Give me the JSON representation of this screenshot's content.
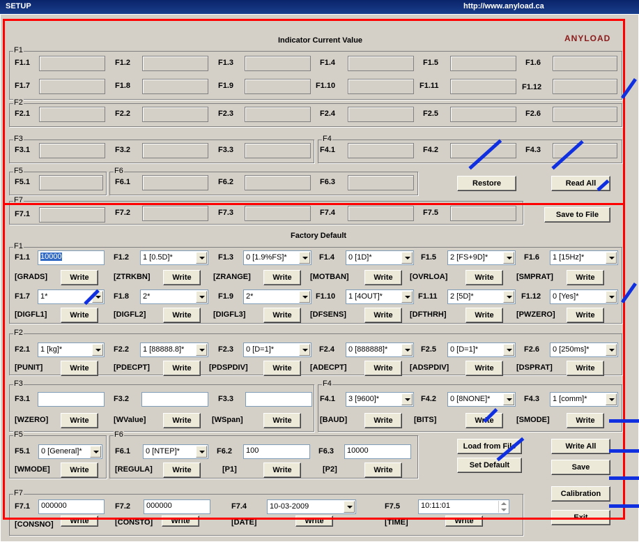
{
  "window": {
    "title": "SETUP",
    "url": "http://www.anyload.ca"
  },
  "brand": "ANYLOAD",
  "current": {
    "title": "Indicator Current Value",
    "groups": [
      "F1",
      "F2",
      "F3",
      "F4",
      "F5",
      "F6",
      "F7"
    ],
    "labels": {
      "f1_1": "F1.1",
      "f1_2": "F1.2",
      "f1_3": "F1.3",
      "f1_4": "F1.4",
      "f1_5": "F1.5",
      "f1_6": "F1.6",
      "f1_7": "F1.7",
      "f1_8": "F1.8",
      "f1_9": "F1.9",
      "f1_10": "F1.10",
      "f1_11": "F1.11",
      "f1_12": "F1.12",
      "f2_1": "F2.1",
      "f2_2": "F2.2",
      "f2_3": "F2.3",
      "f2_4": "F2.4",
      "f2_5": "F2.5",
      "f2_6": "F2.6",
      "f3_1": "F3.1",
      "f3_2": "F3.2",
      "f3_3": "F3.3",
      "f4_1": "F4.1",
      "f4_2": "F4.2",
      "f4_3": "F4.3",
      "f5_1": "F5.1",
      "f6_1": "F6.1",
      "f6_2": "F6.2",
      "f6_3": "F6.3",
      "f7_1": "F7.1",
      "f7_2": "F7.2",
      "f7_3": "F7.3",
      "f7_4": "F7.4",
      "f7_5": "F7.5"
    },
    "buttons": {
      "restore": "Restore",
      "read_all": "Read All",
      "save_to_file": "Save to File"
    }
  },
  "factory": {
    "title": "Factory Default",
    "groups": [
      "F1",
      "F2",
      "F3",
      "F4",
      "F5",
      "F6",
      "F7"
    ],
    "write_label": "Write",
    "f1": {
      "f1_1": {
        "label": "F1.1",
        "value": "10000",
        "code": "[GRADS]"
      },
      "f1_2": {
        "label": "F1.2",
        "value": "1 [0.5D]*",
        "code": "[ZTRKBN]"
      },
      "f1_3": {
        "label": "F1.3",
        "value": "0 [1.9%FS]*",
        "code": "[ZRANGE]"
      },
      "f1_4": {
        "label": "F1.4",
        "value": "0 [1D]*",
        "code": "[MOTBAN]"
      },
      "f1_5": {
        "label": "F1.5",
        "value": "2 [FS+9D]*",
        "code": "[OVRLOA]"
      },
      "f1_6": {
        "label": "F1.6",
        "value": "1 [15Hz]*",
        "code": "[SMPRAT]"
      },
      "f1_7": {
        "label": "F1.7",
        "value": "1*",
        "code": "[DIGFL1]"
      },
      "f1_8": {
        "label": "F1.8",
        "value": "2*",
        "code": "[DIGFL2]"
      },
      "f1_9": {
        "label": "F1.9",
        "value": "2*",
        "code": "[DIGFL3]"
      },
      "f1_10": {
        "label": "F1.10",
        "value": "1 [4OUT]*",
        "code": "[DFSENS]"
      },
      "f1_11": {
        "label": "F1.11",
        "value": "2 [5D]*",
        "code": "[DFTHRH]"
      },
      "f1_12": {
        "label": "F1.12",
        "value": "0 [Yes]*",
        "code": "[PWZERO]"
      }
    },
    "f2": {
      "f2_1": {
        "label": "F2.1",
        "value": "1 [kg]*",
        "code": "[PUNIT]"
      },
      "f2_2": {
        "label": "F2.2",
        "value": "1 [88888.8]*",
        "code": "[PDECPT]"
      },
      "f2_3": {
        "label": "F2.3",
        "value": "0 [D=1]*",
        "code": "[PDSPDIV]"
      },
      "f2_4": {
        "label": "F2.4",
        "value": "0 [888888]*",
        "code": "[ADECPT]"
      },
      "f2_5": {
        "label": "F2.5",
        "value": "0 [D=1]*",
        "code": "[ADSPDIV]"
      },
      "f2_6": {
        "label": "F2.6",
        "value": "0 [250ms]*",
        "code": "[DSPRAT]"
      }
    },
    "f3": {
      "f3_1": {
        "label": "F3.1",
        "value": "",
        "code": "[WZERO]"
      },
      "f3_2": {
        "label": "F3.2",
        "value": "",
        "code": "[WValue]"
      },
      "f3_3": {
        "label": "F3.3",
        "value": "",
        "code": "[WSpan]"
      }
    },
    "f4": {
      "f4_1": {
        "label": "F4.1",
        "value": "3 [9600]*",
        "code": "[BAUD]"
      },
      "f4_2": {
        "label": "F4.2",
        "value": "0 [8NONE]*",
        "code": "[BITS]"
      },
      "f4_3": {
        "label": "F4.3",
        "value": "1 [comm]*",
        "code": "[SMODE]"
      }
    },
    "f5": {
      "f5_1": {
        "label": "F5.1",
        "value": "0 [General]*",
        "code": "[WMODE]"
      }
    },
    "f6": {
      "f6_1": {
        "label": "F6.1",
        "value": "0 [NTEP]*",
        "code": "[REGULA]"
      },
      "f6_2": {
        "label": "F6.2",
        "value": "100",
        "code": "[P1]"
      },
      "f6_3": {
        "label": "F6.3",
        "value": "10000",
        "code": "[P2]"
      }
    },
    "f7": {
      "f7_1": {
        "label": "F7.1",
        "value": "000000",
        "code": "[CONSNO]"
      },
      "f7_2": {
        "label": "F7.2",
        "value": "000000",
        "code": "[CONSTO]"
      },
      "f7_4": {
        "label": "F7.4",
        "value": "10-03-2009",
        "code": "[DATE]"
      },
      "f7_5": {
        "label": "F7.5",
        "value": "10:11:01",
        "code": "[TIME]"
      }
    },
    "buttons": {
      "load_from_file": "Load from File",
      "write_all": "Write All",
      "set_default": "Set Default",
      "save": "Save",
      "calibration": "Calibration",
      "exit": "Exit"
    }
  },
  "colors": {
    "highlight": "#ff0000",
    "annotation": "#1030e0",
    "selection": "#316ac5"
  }
}
